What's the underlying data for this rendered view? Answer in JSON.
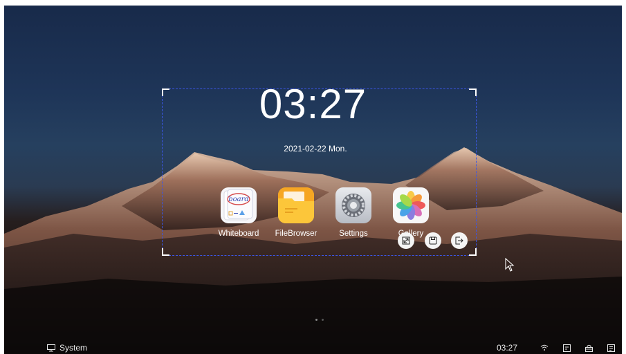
{
  "clock": {
    "time": "03:27",
    "date": "2021-02-22  Mon."
  },
  "apps": [
    {
      "label": "Whiteboard",
      "icon": "whiteboard-icon"
    },
    {
      "label": "FileBrowser",
      "icon": "folder-icon"
    },
    {
      "label": "Settings",
      "icon": "gear-icon"
    },
    {
      "label": "Gallery",
      "icon": "pinwheel-icon"
    }
  ],
  "whiteboard_icon_text": "board",
  "page_indicator": {
    "pages": 2,
    "current": 1
  },
  "taskbar": {
    "system_label": "System",
    "time": "03:27",
    "icons": [
      "wifi-icon",
      "screenshot-icon",
      "lock-icon",
      "menu-icon"
    ]
  },
  "selection_tools": [
    "expand-icon",
    "save-icon",
    "exit-icon"
  ],
  "colors": {
    "selection_border": "#3b56e6",
    "folder": "#f7b72b"
  }
}
